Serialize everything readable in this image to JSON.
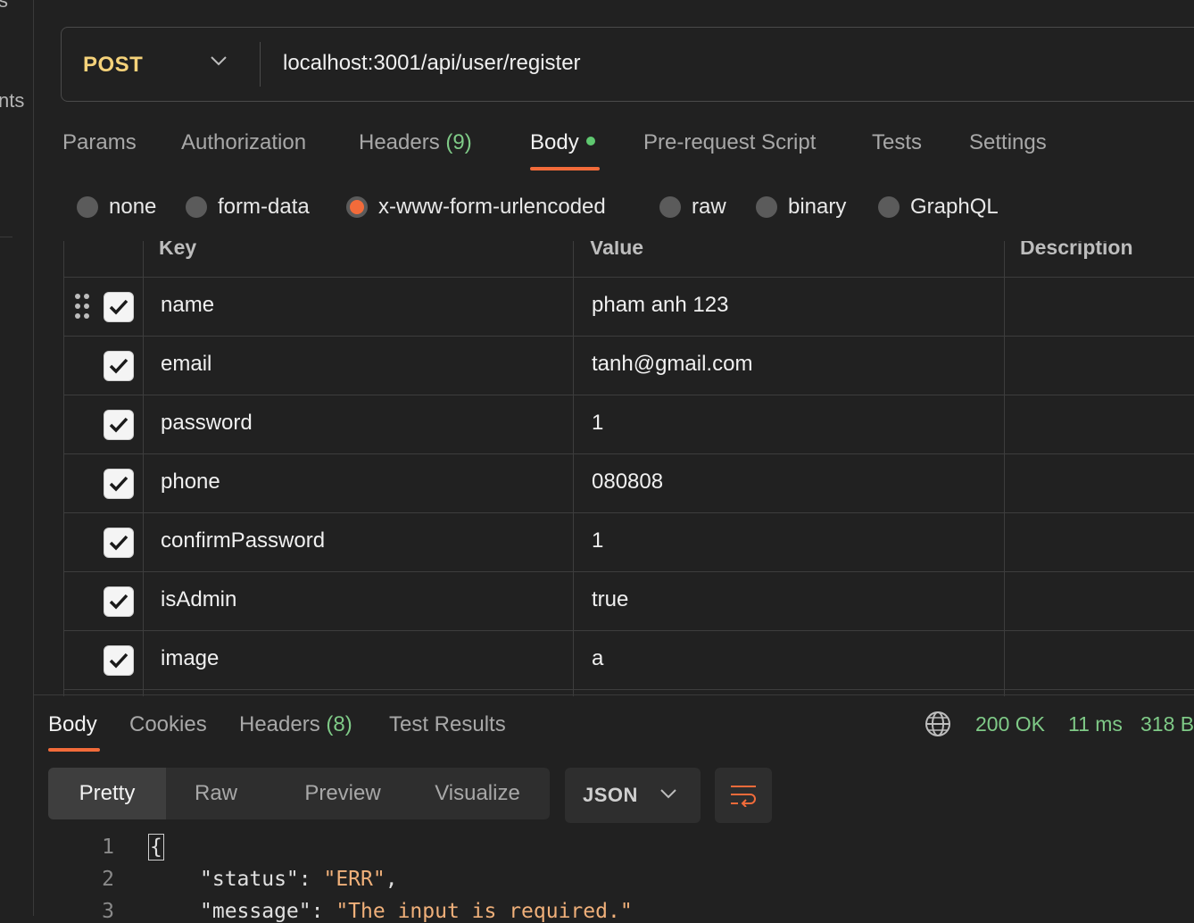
{
  "sidebar": {
    "fragments": [
      "s",
      "nts"
    ]
  },
  "request": {
    "method": "POST",
    "url": "localhost:3001/api/user/register"
  },
  "request_tabs": [
    {
      "label": "Params"
    },
    {
      "label": "Authorization"
    },
    {
      "label": "Headers",
      "count": "(9)"
    },
    {
      "label": "Body",
      "active": true
    },
    {
      "label": "Pre-request Script"
    },
    {
      "label": "Tests"
    },
    {
      "label": "Settings"
    }
  ],
  "body_types": [
    {
      "label": "none"
    },
    {
      "label": "form-data"
    },
    {
      "label": "x-www-form-urlencoded",
      "selected": true
    },
    {
      "label": "raw"
    },
    {
      "label": "binary"
    },
    {
      "label": "GraphQL"
    }
  ],
  "table": {
    "headers": [
      "Key",
      "Value",
      "Description"
    ],
    "rows": [
      {
        "key": "name",
        "value": "pham anh 123",
        "checked": true
      },
      {
        "key": "email",
        "value": "tanh@gmail.com",
        "checked": true
      },
      {
        "key": "password",
        "value": "1",
        "checked": true
      },
      {
        "key": "phone",
        "value": "080808",
        "checked": true
      },
      {
        "key": "confirmPassword",
        "value": "1",
        "checked": true
      },
      {
        "key": "isAdmin",
        "value": "true",
        "checked": true
      },
      {
        "key": "image",
        "value": "a",
        "checked": true
      }
    ]
  },
  "response_tabs": [
    {
      "label": "Body",
      "active": true
    },
    {
      "label": "Cookies"
    },
    {
      "label": "Headers",
      "count": "(8)"
    },
    {
      "label": "Test Results"
    }
  ],
  "response_status": {
    "status": "200 OK",
    "time": "11 ms",
    "size": "318 B"
  },
  "format_tabs": [
    {
      "label": "Pretty",
      "active": true
    },
    {
      "label": "Raw"
    },
    {
      "label": "Preview"
    },
    {
      "label": "Visualize"
    }
  ],
  "language": "JSON",
  "code": {
    "line_numbers": [
      "1",
      "2",
      "3"
    ],
    "line1": "{",
    "line2_key": "\"status\"",
    "line2_sep": ": ",
    "line2_value": "\"ERR\"",
    "line2_end": ",",
    "line3_key": "\"message\"",
    "line3_sep": ": ",
    "line3_value": "\"The input is required.\""
  },
  "colors": {
    "accent": "#f26b3a",
    "method": "#f5d27a",
    "success": "#7fca87",
    "background": "#212121"
  },
  "icons": [
    "chevron-down-icon",
    "drag-handle-icon",
    "checkbox-check-icon",
    "globe-icon",
    "wrap-lines-icon"
  ]
}
